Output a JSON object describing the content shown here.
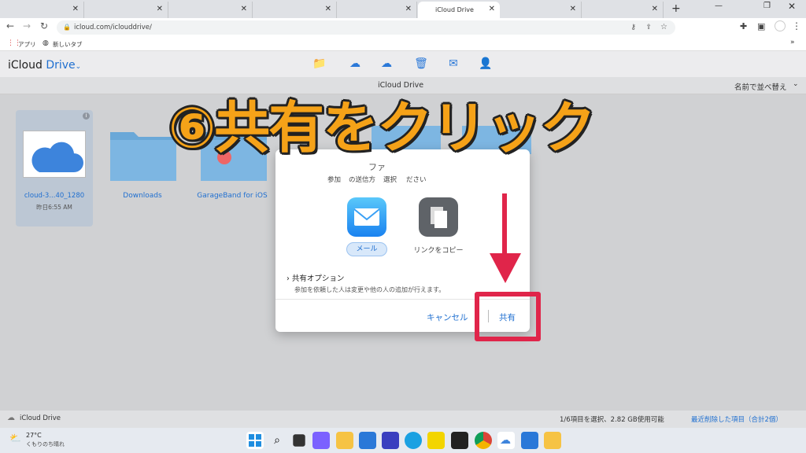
{
  "browser": {
    "active_tab": "iCloud Drive",
    "url": "icloud.com/iclouddrive/",
    "bookmarks": [
      "アプリ",
      "新しいタブ"
    ]
  },
  "app": {
    "title": "iCloud",
    "title_accent": "Drive",
    "subtitle": "iCloud Drive",
    "sort_label": "名前で並べ替え"
  },
  "files": [
    {
      "name": "cloud-3...40_1280",
      "date": "昨日6:55 AM"
    },
    {
      "name": "Downloads",
      "date": ""
    },
    {
      "name": "GarageBand for iOS",
      "date": ""
    }
  ],
  "dialog": {
    "title_partial": "ファ",
    "subtitle": "参加",
    "subtitle_rest": "の送信方",
    "subtitle_end": "選択",
    "subtitle_tail": "ださい",
    "option_mail": "メール",
    "option_link": "リンクをコピー",
    "share_options": "共有オプション",
    "share_desc": "参加を依頼した人は変更や他の人の追加が行えます。",
    "cancel": "キャンセル",
    "share": "共有"
  },
  "overlay": {
    "text": "⑥共有をクリック"
  },
  "status": {
    "left": "iCloud Drive",
    "selection": "1/6項目を選択、2.82 GB使用可能",
    "recent": "最近削除した項目（合計2個）"
  },
  "weather": {
    "temp": "27°C",
    "desc": "くもりのち晴れ"
  },
  "colors": {
    "accent": "#1f6fd0",
    "overlay": "#f5a218",
    "highlight": "#e0254a",
    "arrow": "#e0254a"
  }
}
